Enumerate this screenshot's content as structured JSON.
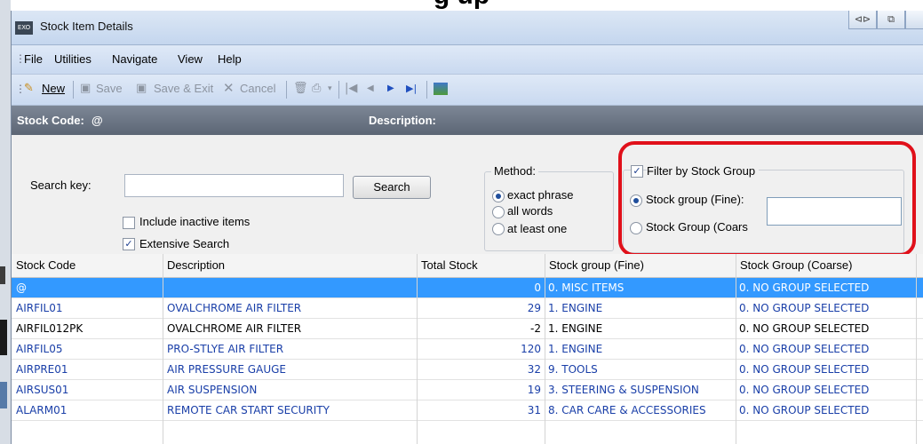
{
  "background_title": "g up",
  "window": {
    "app_icon": "EXO",
    "title": "Stock Item Details"
  },
  "menu": [
    "File",
    "Utilities",
    "Navigate",
    "View",
    "Help"
  ],
  "toolbar": {
    "new_label": "New",
    "save_label": "Save",
    "save_exit_label": "Save & Exit",
    "cancel_label": "Cancel"
  },
  "header": {
    "stock_code_label": "Stock Code:",
    "stock_code_value": "@",
    "description_label": "Description:"
  },
  "search": {
    "key_label": "Search key:",
    "key_value": "",
    "search_button": "Search",
    "include_inactive_label": "Include inactive items",
    "include_inactive_checked": false,
    "extensive_search_label": "Extensive Search",
    "extensive_search_checked": true
  },
  "method": {
    "label": "Method:",
    "options": [
      "exact phrase",
      "all words",
      "at least one"
    ],
    "selected": "exact phrase"
  },
  "filter": {
    "filter_label": "Filter by Stock Group",
    "filter_checked": true,
    "fine_label": "Stock group (Fine):",
    "coarse_label": "Stock Group (Coars",
    "selected": "fine",
    "group_value": ""
  },
  "highlight_color": "#e0101a",
  "table": {
    "columns": [
      "Stock Code",
      "Description",
      "Total Stock",
      "Stock group (Fine)",
      "Stock Group (Coarse)"
    ],
    "rows": [
      {
        "code": "@",
        "desc": "",
        "total": "0",
        "fine": "0. MISC ITEMS",
        "coarse": "0. NO GROUP SELECTED",
        "selected": true
      },
      {
        "code": "AIRFIL01",
        "desc": "OVALCHROME AIR FILTER",
        "total": "29",
        "fine": "1. ENGINE",
        "coarse": "0. NO GROUP SELECTED",
        "style": "blue"
      },
      {
        "code": "AIRFIL012PK",
        "desc": "OVALCHROME AIR FILTER",
        "total": "-2",
        "fine": "1. ENGINE",
        "coarse": "0. NO GROUP SELECTED",
        "style": "blk"
      },
      {
        "code": "AIRFIL05",
        "desc": "PRO-STLYE AIR FILTER",
        "total": "120",
        "fine": "1. ENGINE",
        "coarse": "0. NO GROUP SELECTED",
        "style": "blue"
      },
      {
        "code": "AIRPRE01",
        "desc": "AIR PRESSURE GAUGE",
        "total": "32",
        "fine": "9. TOOLS",
        "coarse": "0. NO GROUP SELECTED",
        "style": "blue"
      },
      {
        "code": "AIRSUS01",
        "desc": "AIR SUSPENSION",
        "total": "19",
        "fine": "3. STEERING & SUSPENSION",
        "coarse": "0. NO GROUP SELECTED",
        "style": "blue"
      },
      {
        "code": "ALARM01",
        "desc": "REMOTE CAR START SECURITY",
        "total": "31",
        "fine": "8. CAR CARE & ACCESSORIES",
        "coarse": "0. NO GROUP SELECTED",
        "style": "blue"
      }
    ]
  }
}
